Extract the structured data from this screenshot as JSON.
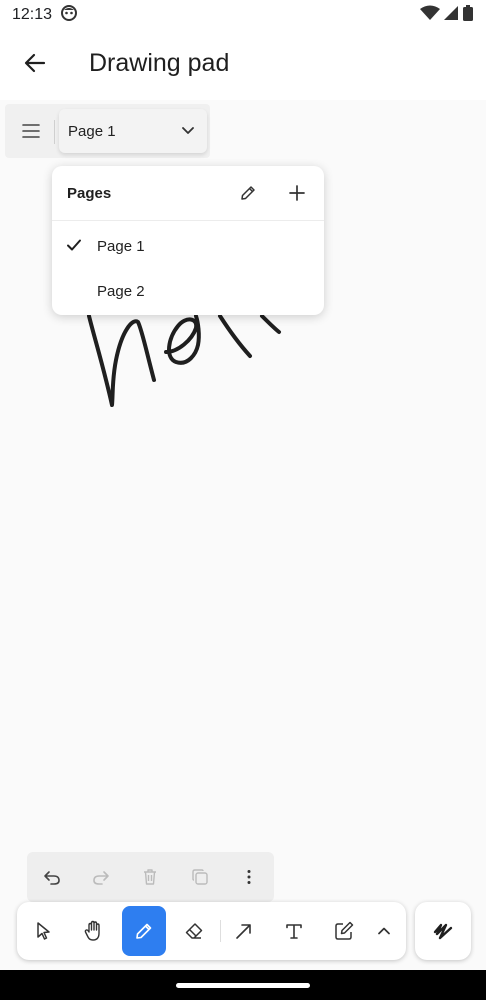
{
  "status_bar": {
    "time": "12:13",
    "icons": [
      "app-notification-icon",
      "wifi-icon",
      "signal-icon",
      "battery-icon"
    ]
  },
  "app_bar": {
    "title": "Drawing pad",
    "back_icon": "arrow-left-icon"
  },
  "page_selector": {
    "menu_icon": "hamburger-menu-icon",
    "current_page": "Page 1",
    "dropdown_icon": "chevron-down-icon"
  },
  "pages_popup": {
    "title": "Pages",
    "edit_icon": "pencil-icon",
    "add_icon": "plus-icon",
    "items": [
      {
        "label": "Page 1",
        "selected": true
      },
      {
        "label": "Page 2",
        "selected": false
      }
    ]
  },
  "edit_toolbar": {
    "buttons": [
      "undo-icon",
      "redo-icon",
      "delete-icon",
      "duplicate-icon",
      "more-vert-icon"
    ],
    "disabled": [
      "redo-icon",
      "delete-icon",
      "duplicate-icon"
    ]
  },
  "tool_bar": {
    "tools": [
      "select-icon",
      "hand-icon",
      "pen-icon",
      "eraser-icon",
      "arrow-icon",
      "text-icon",
      "note-icon",
      "chevron-up-icon"
    ],
    "active_tool": "pen-icon",
    "auto_icon": "scribble-icon",
    "accent_color": "#2e7ef0"
  }
}
